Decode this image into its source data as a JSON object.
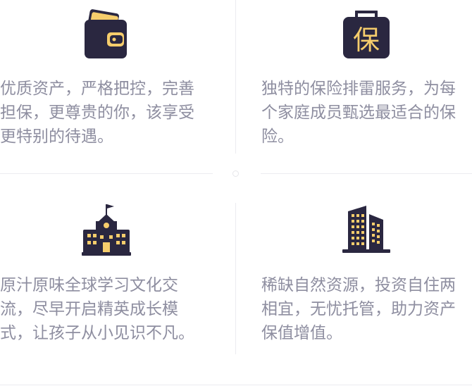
{
  "colors": {
    "icon_dark": "#2a2740",
    "icon_accent": "#f6cd6c",
    "text": "#8e8ea0",
    "divider": "#ececf0"
  },
  "features": [
    {
      "icon": "wallet-icon",
      "lines": [
        "优质资产，严格把控，完善",
        "担保，更尊贵的你，该享受",
        "更特别的待遇。"
      ]
    },
    {
      "icon": "insurance-badge-icon",
      "icon_text": "保",
      "lines": [
        "独特的保险排雷服务，为每",
        "个家庭成员甄选最适合的保",
        "险。"
      ]
    },
    {
      "icon": "school-building-icon",
      "lines": [
        "原汁原味全球学习文化交",
        "流，尽早开启精英成长模",
        "式，让孩子从小见识不凡。"
      ]
    },
    {
      "icon": "skyscraper-icon",
      "lines": [
        "稀缺自然资源，投资自住两",
        "相宜，无忧托管，助力资产",
        "保值增值。"
      ]
    }
  ]
}
